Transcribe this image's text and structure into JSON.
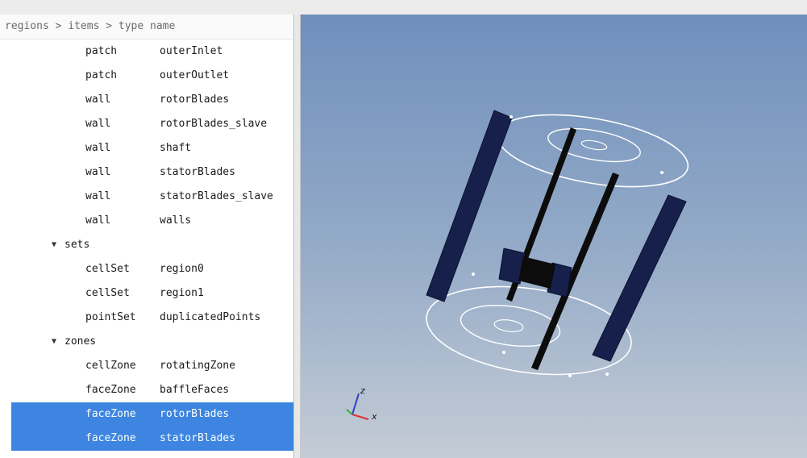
{
  "breadcrumb": "regions > items > type name",
  "rows_before": [
    {
      "type": "patch",
      "name": "outerInlet"
    },
    {
      "type": "patch",
      "name": "outerOutlet"
    },
    {
      "type": "wall",
      "name": "rotorBlades"
    },
    {
      "type": "wall",
      "name": "rotorBlades_slave"
    },
    {
      "type": "wall",
      "name": "shaft"
    },
    {
      "type": "wall",
      "name": "statorBlades"
    },
    {
      "type": "wall",
      "name": "statorBlades_slave"
    },
    {
      "type": "wall",
      "name": "walls"
    }
  ],
  "sets_label": "sets",
  "sets": [
    {
      "type": "cellSet",
      "name": "region0"
    },
    {
      "type": "cellSet",
      "name": "region1"
    },
    {
      "type": "pointSet",
      "name": "duplicatedPoints"
    }
  ],
  "zones_label": "zones",
  "zones": [
    {
      "type": "cellZone",
      "name": "rotatingZone"
    },
    {
      "type": "faceZone",
      "name": "baffleFaces"
    },
    {
      "type": "faceZone",
      "name": "rotorBlades"
    },
    {
      "type": "faceZone",
      "name": "statorBlades"
    }
  ],
  "axes": {
    "z": "z",
    "x": "x"
  },
  "colors": {
    "selection": "#3d85e0",
    "blade": "#16204a",
    "wireframe": "#ffffff"
  }
}
